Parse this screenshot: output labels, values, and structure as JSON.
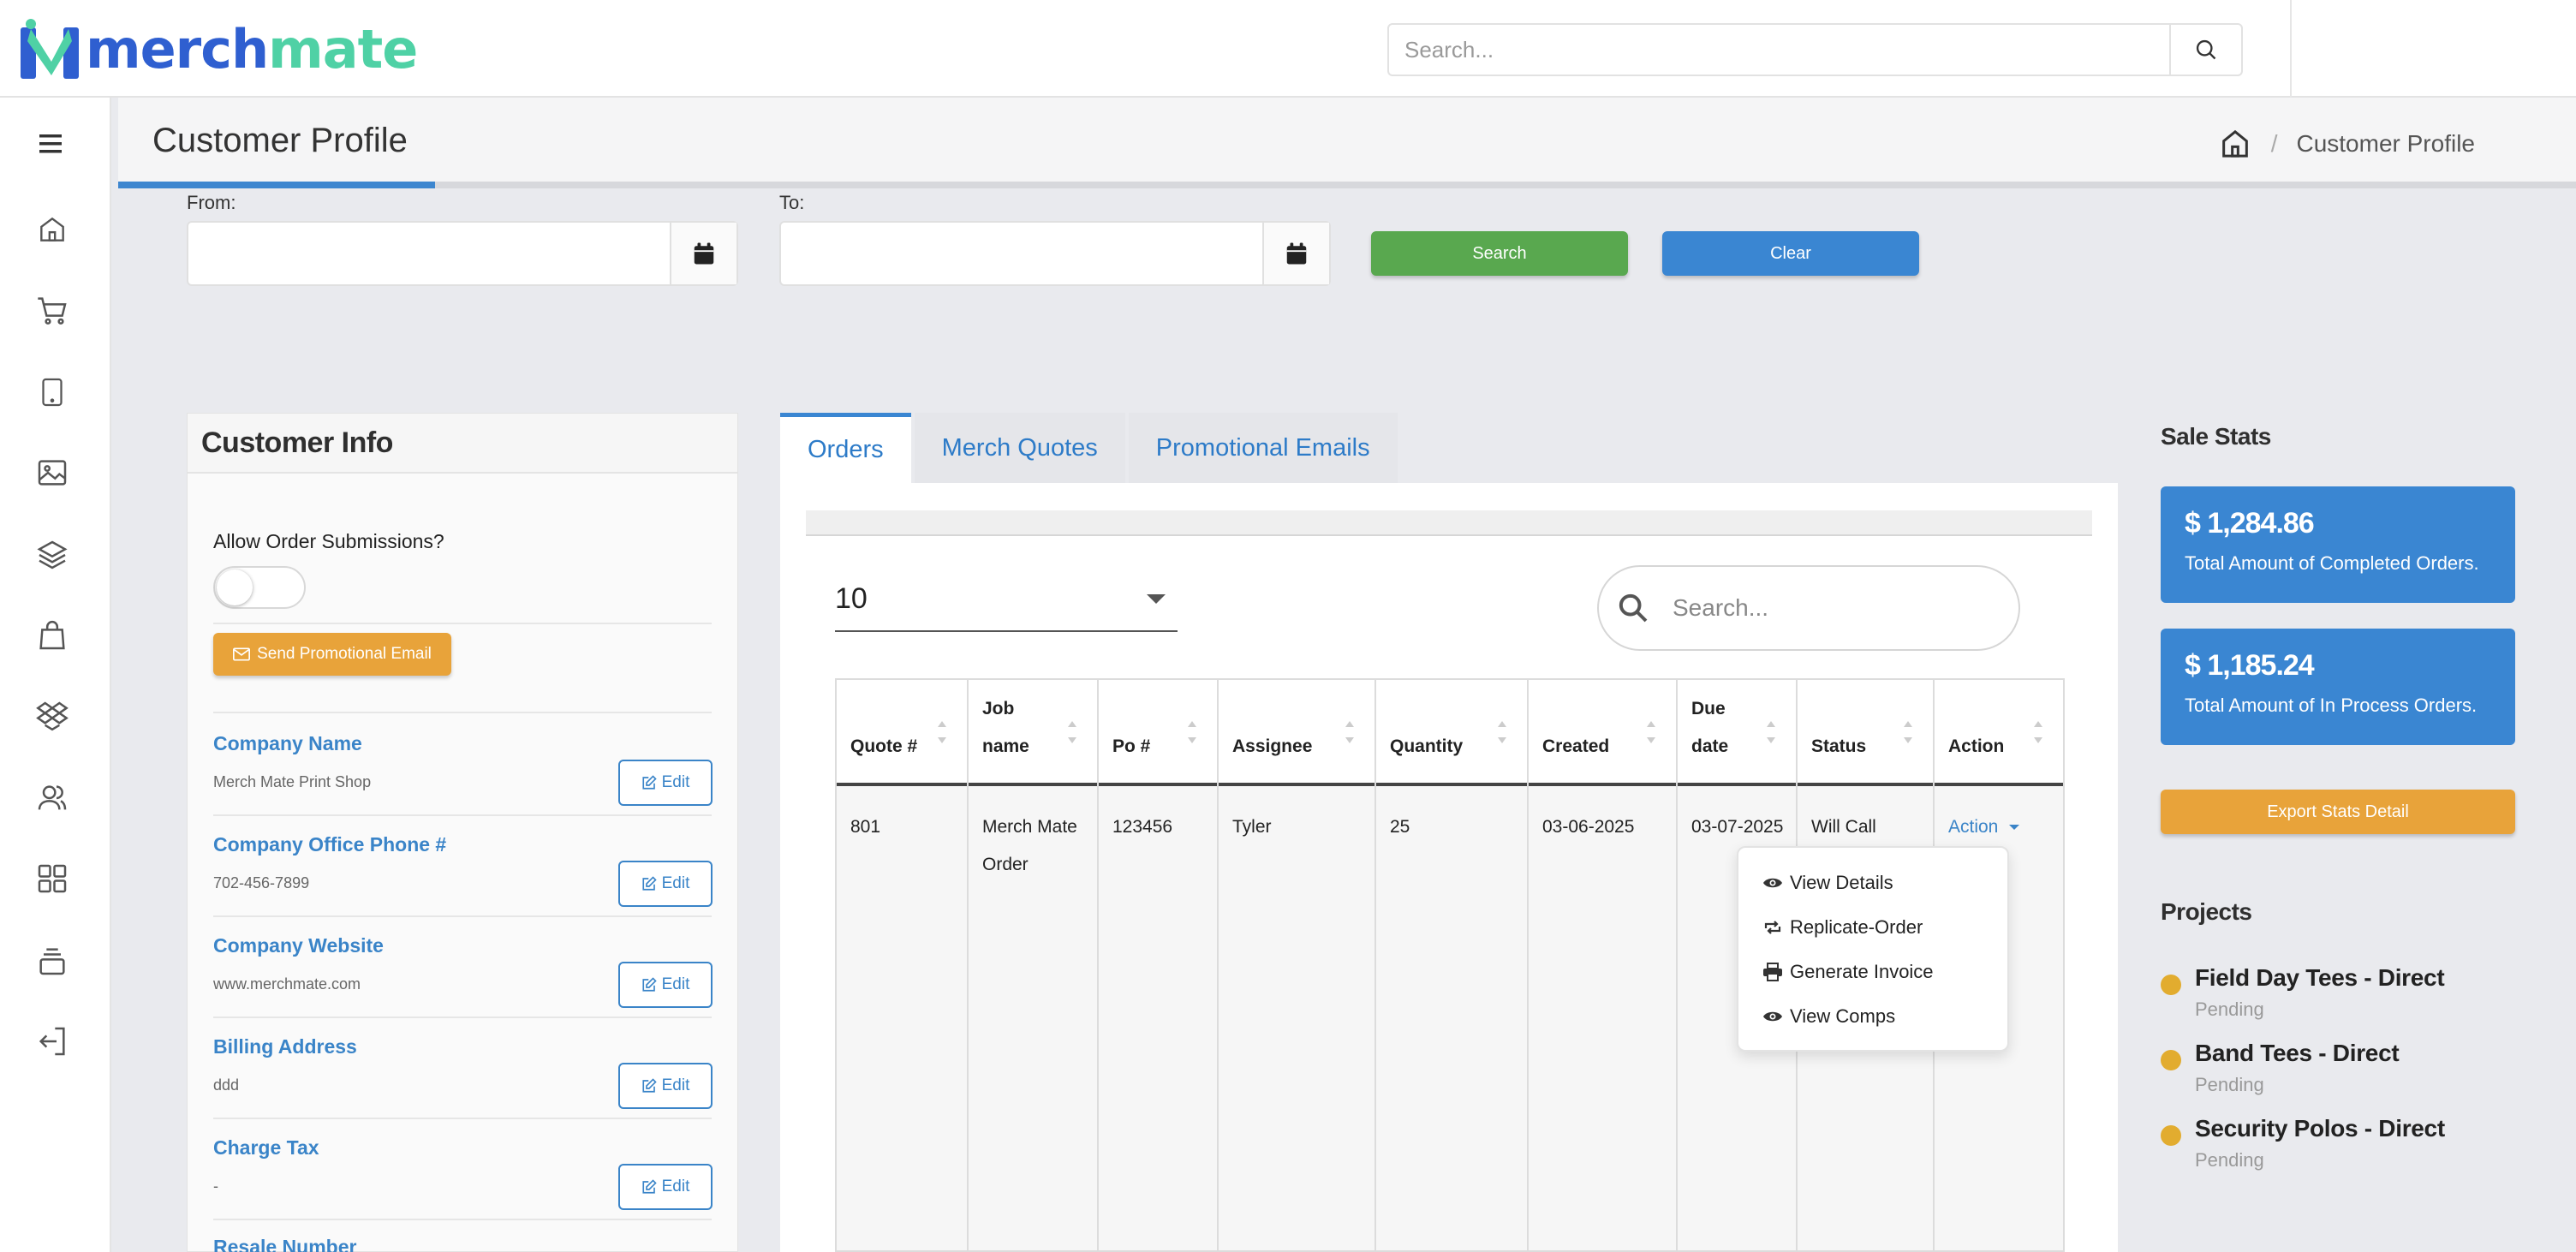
{
  "app": {
    "name_part1": "merch",
    "name_part2": "mate",
    "brand_blue": "#2f5fd0",
    "brand_green": "#4fd1a5"
  },
  "header": {
    "search_placeholder": "Search...",
    "search_icon": "search-icon"
  },
  "sidebar": {
    "items": [
      {
        "icon": "menu-icon"
      },
      {
        "icon": "home-icon"
      },
      {
        "icon": "cart-icon"
      },
      {
        "icon": "tablet-icon"
      },
      {
        "icon": "image-icon"
      },
      {
        "icon": "layers-icon"
      },
      {
        "icon": "shopping-bag-icon"
      },
      {
        "icon": "dropbox-icon"
      },
      {
        "icon": "users-icon"
      },
      {
        "icon": "grid-icon"
      },
      {
        "icon": "stack-icon"
      },
      {
        "icon": "logout-icon"
      }
    ]
  },
  "page": {
    "title": "Customer Profile",
    "breadcrumb_current": "Customer Profile",
    "breadcrumb_sep": "/"
  },
  "filters": {
    "from_label": "From:",
    "to_label": "To:",
    "search_button": "Search",
    "clear_button": "Clear"
  },
  "customer_info": {
    "title": "Customer Info",
    "allow_label": "Allow Order Submissions?",
    "allow_enabled": false,
    "promo_button": "Send Promotional Email",
    "edit_label": "Edit",
    "fields": [
      {
        "title": "Company Name",
        "value": "Merch Mate Print Shop"
      },
      {
        "title": "Company Office Phone #",
        "value": "702-456-7899"
      },
      {
        "title": "Company Website",
        "value": "www.merchmate.com"
      },
      {
        "title": "Billing Address",
        "value": "ddd"
      },
      {
        "title": "Charge Tax",
        "value": "-"
      },
      {
        "title": "Resale Number",
        "value": ""
      }
    ]
  },
  "tabs": [
    "Orders",
    "Merch Quotes",
    "Promotional Emails"
  ],
  "orders": {
    "page_length": "10",
    "search_placeholder": "Search...",
    "columns": [
      {
        "line1": "",
        "line2": "Quote #"
      },
      {
        "line1": "Job",
        "line2": "name"
      },
      {
        "line1": "",
        "line2": "Po #"
      },
      {
        "line1": "",
        "line2": "Assignee"
      },
      {
        "line1": "",
        "line2": "Quantity"
      },
      {
        "line1": "",
        "line2": "Created"
      },
      {
        "line1": "Due",
        "line2": "date"
      },
      {
        "line1": "",
        "line2": "Status"
      },
      {
        "line1": "",
        "line2": "Action"
      }
    ],
    "rows": [
      {
        "quote": "801",
        "job_name_1": "Merch Mate",
        "job_name_2": "Order",
        "po": "123456",
        "assignee": "Tyler",
        "quantity": "25",
        "created": "03-06-2025",
        "due_date": "03-07-2025",
        "status": "Will Call",
        "action": "Action"
      }
    ],
    "action_menu": [
      {
        "label": "View Details",
        "icon": "eye-icon"
      },
      {
        "label": "Replicate-Order",
        "icon": "repeat-icon"
      },
      {
        "label": "Generate Invoice",
        "icon": "printer-icon"
      },
      {
        "label": "View Comps",
        "icon": "eye-icon"
      }
    ]
  },
  "sale_stats": {
    "title": "Sale Stats",
    "completed_amount": "$ 1,284.86",
    "completed_label": "Total Amount of Completed Orders.",
    "inprocess_amount": "$ 1,185.24",
    "inprocess_label": "Total Amount of In Process Orders.",
    "export_button": "Export Stats Detail"
  },
  "projects": {
    "title": "Projects",
    "items": [
      {
        "name": "Field Day Tees - Direct",
        "status": "Pending"
      },
      {
        "name": "Band Tees - Direct",
        "status": "Pending"
      },
      {
        "name": "Security Polos - Direct",
        "status": "Pending"
      }
    ]
  },
  "colors": {
    "primary": "#3a86d2",
    "success": "#59a84f",
    "warning": "#e8a33a",
    "pending_dot": "#e2ac2f"
  }
}
